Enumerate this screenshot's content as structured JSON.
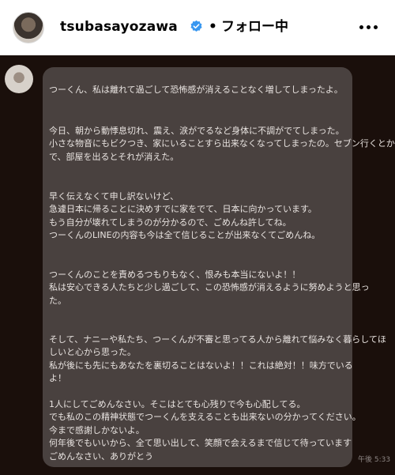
{
  "header": {
    "username": "tsubasayozawa",
    "separator": "•",
    "follow_status": "フォロー中",
    "verified_icon": "verified-badge-icon",
    "more_icon": "more-options-icon",
    "verified_color": "#3897f0"
  },
  "message": {
    "paragraphs": [
      "つーくん、私は離れて過ごして恐怖感が消えることなく増してしまったよ。",
      "今日、朝から動悸息切れ、震え、涙がでるなど身体に不調がでてしまった。\n小さな物音にもビクつき、家にいることすら出来なくなってしまったの。セブン行くとか\nで、部屋を出るとそれが消えた。",
      "早く伝えなくて申し訳ないけど、\n急遽日本に帰ることに決めすでに家をでて、日本に向かっています。\nもう自分が壊れてしまうのが分かるので、ごめんね許してね。\nつーくんのLINEの内容も今は全て信じることが出来なくてごめんね。",
      "つーくんのことを責めるつもりもなく、恨みも本当にないよ！！\n私は安心できる人たちと少し過ごして、この恐怖感が消えるように努めようと思っ\nた。",
      "そして、ナニーや私たち、つーくんが不審と思ってる人から離れて悩みなく暮らしてほ\nしいと心から思った。\n私が後にも先にもあなたを裏切ることはないよ！！これは絶対！！味方でいる\nよ！",
      "1人にしてごめんなさい。そこはとても心残りで今も心配してる。\nでも私のこの精神状態でつーくんを支えることも出来ないの分かってください。\n今まで感謝しかないよ。\n何年後でもいいから、全て思い出して、笑顔で会えるまで信じて待っています\nごめんなさい、ありがとう"
    ],
    "timestamp": "午後 5:33",
    "bubble_color": "#49413f",
    "background_color": "#1a0f0b"
  }
}
